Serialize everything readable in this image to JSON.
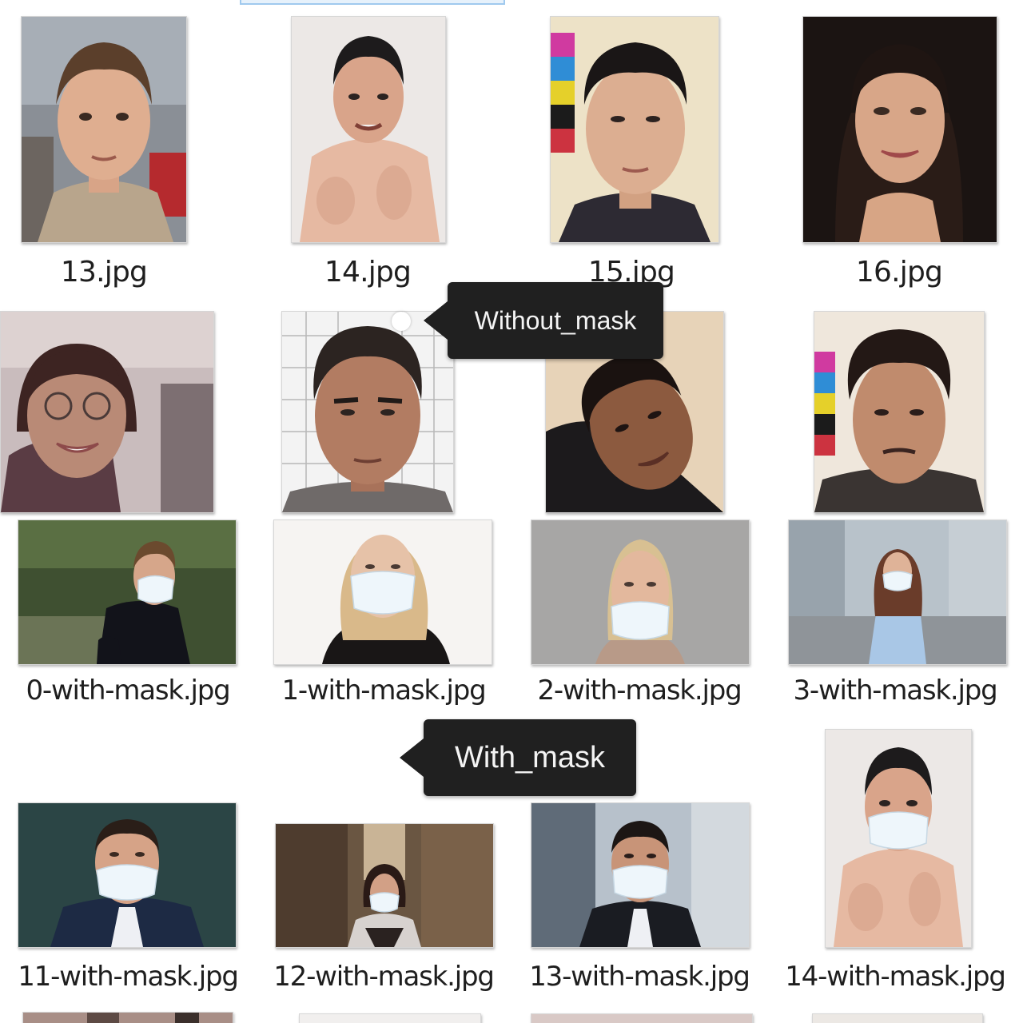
{
  "rows": [
    {
      "files": [
        {
          "name": "13.jpg",
          "subject": "boy-portrait"
        },
        {
          "name": "14.jpg",
          "subject": "shirtless-man"
        },
        {
          "name": "15.jpg",
          "subject": "young-man-portrait"
        },
        {
          "name": "16.jpg",
          "subject": "woman-portrait"
        }
      ]
    },
    {
      "files": [
        {
          "subject": "girl-with-glasses"
        },
        {
          "subject": "man-grid-background"
        },
        {
          "subject": "tilted-head-man"
        },
        {
          "subject": "curly-hair-man"
        }
      ]
    },
    {
      "files": [
        {
          "name": "0-with-mask.jpg",
          "subject": "masked-man-hedge"
        },
        {
          "name": "1-with-mask.jpg",
          "subject": "masked-blonde-woman"
        },
        {
          "name": "2-with-mask.jpg",
          "subject": "masked-woman-grey"
        },
        {
          "name": "3-with-mask.jpg",
          "subject": "masked-woman-street"
        }
      ]
    },
    {
      "files": [
        {
          "name": "11-with-mask.jpg",
          "subject": "masked-man-suit"
        },
        {
          "name": "12-with-mask.jpg",
          "subject": "masked-woman-alley"
        },
        {
          "name": "13-with-mask.jpg",
          "subject": "masked-man-city"
        },
        {
          "name": "14-with-mask.jpg",
          "subject": "masked-shirtless-man"
        }
      ]
    }
  ],
  "annotations": {
    "without_mask": "Without_mask",
    "with_mask": "With_mask"
  },
  "colors": {
    "callout_bg": "#202020",
    "callout_text": "#f4f4f4",
    "selection_border": "#9fc9ee",
    "mask": "#eef6fb"
  },
  "icons": [
    "callout-arrow-icon",
    "cursor-dot-icon"
  ]
}
